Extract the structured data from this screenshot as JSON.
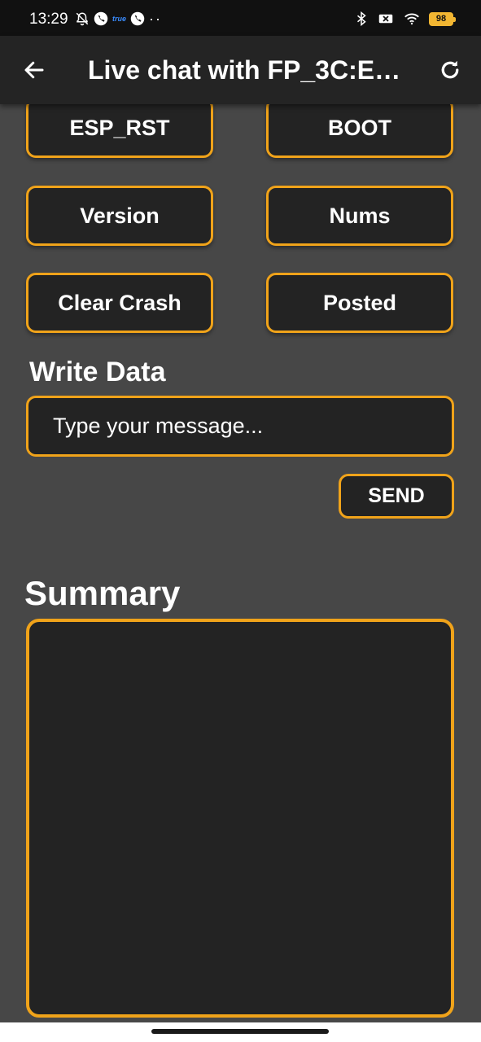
{
  "status_bar": {
    "time": "13:29",
    "carrier_badge": "true",
    "battery": "98",
    "left_icons": [
      "bell-off-icon",
      "phone-icon",
      "carrier-badge",
      "phone-icon",
      "more-dots-icon"
    ],
    "right_icons": [
      "bluetooth-icon",
      "no-sim-icon",
      "wifi-icon",
      "battery-icon"
    ]
  },
  "app_bar": {
    "title": "Live chat with FP_3C:E…",
    "back_icon": "arrow-back-icon",
    "refresh_icon": "refresh-icon"
  },
  "commands": [
    {
      "label": "ESP_RST"
    },
    {
      "label": "BOOT"
    },
    {
      "label": "Version"
    },
    {
      "label": "Nums"
    },
    {
      "label": "Clear Crash"
    },
    {
      "label": "Posted"
    }
  ],
  "write": {
    "label": "Write Data",
    "placeholder": "Type your message...",
    "send_label": "SEND"
  },
  "summary": {
    "label": "Summary",
    "content": ""
  },
  "colors": {
    "accent": "#f0a31a",
    "background": "#474747",
    "surface": "#232323",
    "app_bar": "#242424"
  }
}
